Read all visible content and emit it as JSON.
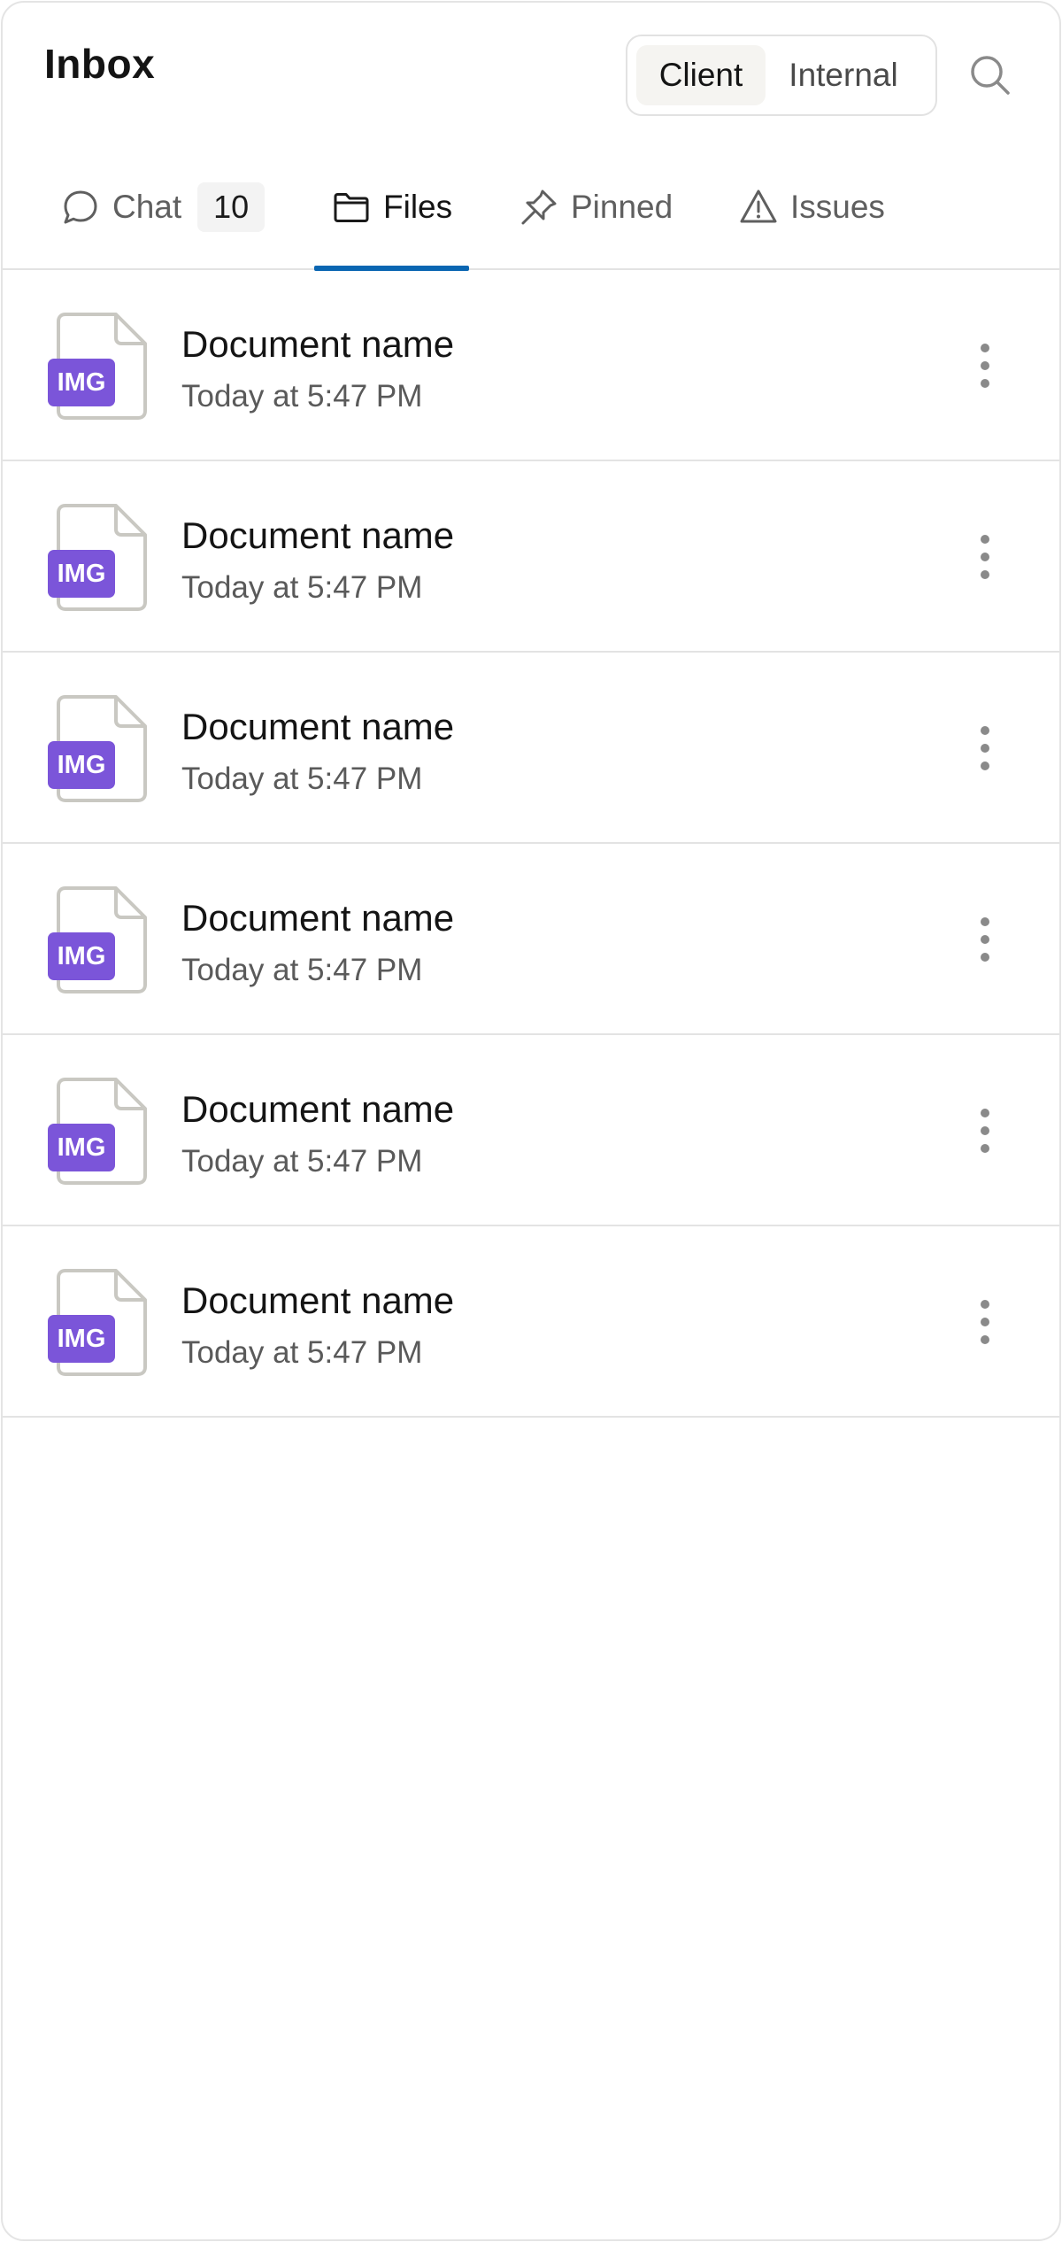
{
  "header": {
    "title": "Inbox",
    "segments": [
      {
        "label": "Client",
        "active": true
      },
      {
        "label": "Internal",
        "active": false
      }
    ],
    "search_icon": "search-icon"
  },
  "tabs": [
    {
      "label": "Chat",
      "icon": "chat-bubble-icon",
      "badge": "10",
      "active": false
    },
    {
      "label": "Files",
      "icon": "folder-icon",
      "active": true
    },
    {
      "label": "Pinned",
      "icon": "pin-icon",
      "active": false
    },
    {
      "label": "Issues",
      "icon": "warning-icon",
      "active": false
    }
  ],
  "files": [
    {
      "name": "Document name",
      "time": "Today at 5:47 PM",
      "type": "IMG"
    },
    {
      "name": "Document name",
      "time": "Today at 5:47 PM",
      "type": "IMG"
    },
    {
      "name": "Document name",
      "time": "Today at 5:47 PM",
      "type": "IMG"
    },
    {
      "name": "Document name",
      "time": "Today at 5:47 PM",
      "type": "IMG"
    },
    {
      "name": "Document name",
      "time": "Today at 5:47 PM",
      "type": "IMG"
    },
    {
      "name": "Document name",
      "time": "Today at 5:47 PM",
      "type": "IMG"
    }
  ],
  "colors": {
    "accent_underline": "#0a66b2",
    "file_badge": "#7b55d9"
  }
}
